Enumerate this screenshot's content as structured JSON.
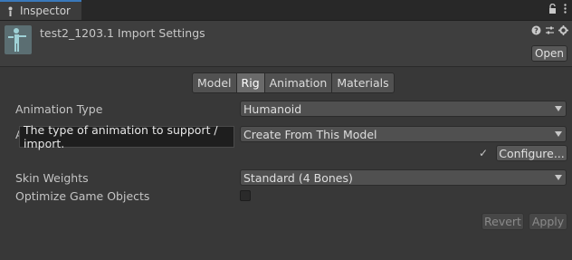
{
  "window": {
    "tab_label": "Inspector"
  },
  "header": {
    "title": "test2_1203.1 Import Settings",
    "open_label": "Open"
  },
  "tabs": [
    {
      "label": "Model"
    },
    {
      "label": "Rig"
    },
    {
      "label": "Animation"
    },
    {
      "label": "Materials"
    }
  ],
  "active_tab": "Rig",
  "fields": {
    "animation_type": {
      "label": "Animation Type",
      "value": "Humanoid"
    },
    "avatar_definition": {
      "label": "A",
      "value": "Create From This Model"
    },
    "skin_weights": {
      "label": "Skin Weights",
      "value": "Standard (4 Bones)"
    },
    "optimize_game_objects": {
      "label": "Optimize Game Objects",
      "checked": false
    }
  },
  "tooltip": "The type of animation to support / import.",
  "configure": {
    "check": "✓",
    "label": "Configure..."
  },
  "footer": {
    "revert_label": "Revert",
    "apply_label": "Apply"
  },
  "icons": {
    "tab": "inspector-icon",
    "lock": "lock-icon",
    "menu": "kebab-menu-icon",
    "help": "help-icon",
    "preset": "preset-icon",
    "settings": "gear-icon",
    "asset": "humanoid-model-icon"
  }
}
